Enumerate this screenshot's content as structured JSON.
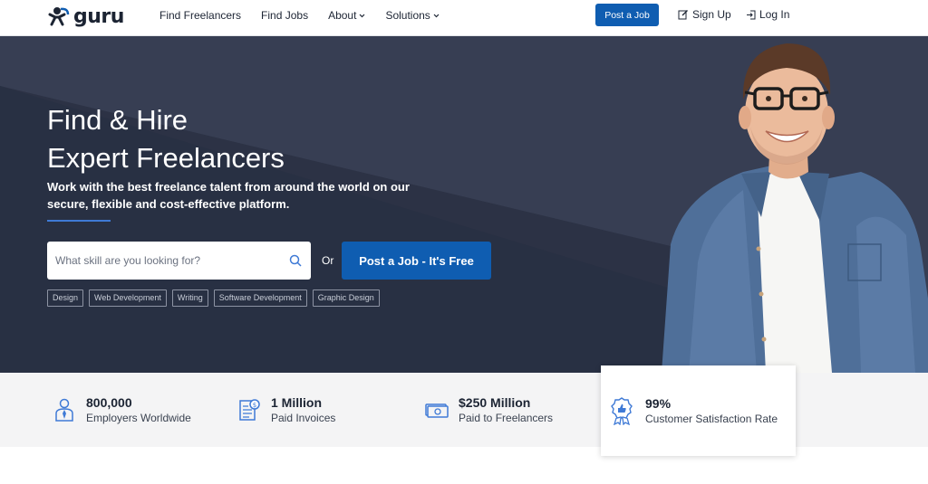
{
  "header": {
    "logo_text": "guru",
    "nav": [
      {
        "label": "Find Freelancers",
        "has_dropdown": false
      },
      {
        "label": "Find Jobs",
        "has_dropdown": false
      },
      {
        "label": "About",
        "has_dropdown": true
      },
      {
        "label": "Solutions",
        "has_dropdown": true
      }
    ],
    "post_job_label": "Post a Job",
    "signup_label": "Sign Up",
    "login_label": "Log In"
  },
  "hero": {
    "title_line1": "Find & Hire",
    "title_line2": "Expert Freelancers",
    "subtitle": "Work with the best freelance talent from around the world on our secure, flexible and cost-effective platform.",
    "search_placeholder": "What skill are you looking for?",
    "or_label": "Or",
    "cta_label": "Post a Job - It's Free",
    "tags": [
      "Design",
      "Web Development",
      "Writing",
      "Software Development",
      "Graphic Design"
    ]
  },
  "stats": [
    {
      "value": "800,000",
      "label": "Employers Worldwide",
      "icon": "employer-icon"
    },
    {
      "value": "1 Million",
      "label": "Paid Invoices",
      "icon": "invoice-icon"
    },
    {
      "value": "$250 Million",
      "label": "Paid to Freelancers",
      "icon": "money-icon"
    },
    {
      "value": "99%",
      "label": "Customer Satisfaction Rate",
      "icon": "award-icon"
    }
  ],
  "colors": {
    "brand_blue": "#0f5db1",
    "hero_bg": "#2c3245",
    "stats_bg": "#f4f4f5",
    "icon_blue": "#3f7ad6"
  }
}
